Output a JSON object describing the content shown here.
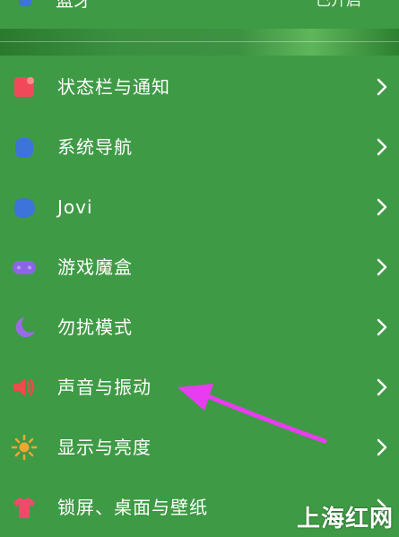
{
  "top_row": {
    "label": "蓝牙",
    "status": "已开启"
  },
  "items": [
    {
      "id": "status-bar",
      "label": "状态栏与通知",
      "icon": "status-bar-icon",
      "color": "#f04a5a"
    },
    {
      "id": "navigation",
      "label": "系统导航",
      "icon": "navigation-icon",
      "color": "#3d74d9"
    },
    {
      "id": "jovi",
      "label": "Jovi",
      "icon": "jovi-icon",
      "color": "#3d74d9"
    },
    {
      "id": "game-box",
      "label": "游戏魔盒",
      "icon": "gamepad-icon",
      "color": "#8a66e6"
    },
    {
      "id": "do-not-disturb",
      "label": "勿扰模式",
      "icon": "moon-icon",
      "color": "#9a6be8"
    },
    {
      "id": "sound-vibration",
      "label": "声音与振动",
      "icon": "speaker-icon",
      "color": "#f04a4a"
    },
    {
      "id": "display-brightness",
      "label": "显示与亮度",
      "icon": "sun-icon",
      "color": "#f2a531"
    },
    {
      "id": "lockscreen-wallpaper",
      "label": "锁屏、桌面与壁纸",
      "icon": "shirt-icon",
      "color": "#f04a6a"
    }
  ],
  "annotation": {
    "type": "arrow",
    "color": "#e83cf0",
    "points_to": "sound-vibration"
  },
  "watermark": "上海红网"
}
